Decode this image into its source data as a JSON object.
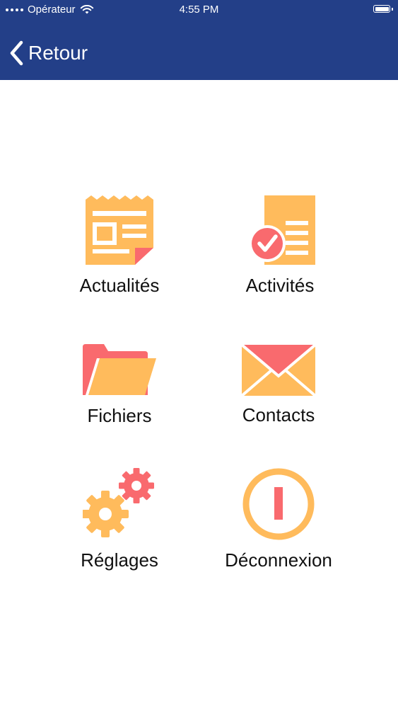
{
  "status_bar": {
    "carrier": "Opérateur",
    "time": "4:55 PM"
  },
  "header": {
    "back_label": "Retour",
    "background_color": "#233f88"
  },
  "colors": {
    "accent_orange": "#ffbb5c",
    "accent_red": "#f96a6e",
    "text": "#111111"
  },
  "menu": {
    "items": [
      {
        "label": "Actualités",
        "icon": "newspaper-icon"
      },
      {
        "label": "Activités",
        "icon": "checked-document-icon"
      },
      {
        "label": "Fichiers",
        "icon": "folder-icon"
      },
      {
        "label": "Contacts",
        "icon": "envelope-icon"
      },
      {
        "label": "Réglages",
        "icon": "gears-icon"
      },
      {
        "label": "Déconnexion",
        "icon": "power-icon"
      }
    ]
  }
}
